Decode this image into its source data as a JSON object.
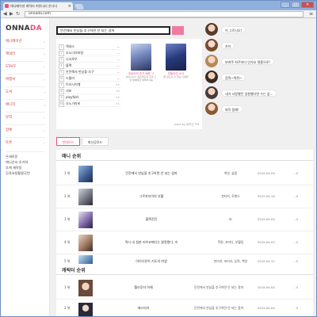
{
  "browser": {
    "tab_title": "애니메이션 캐릭터 커뮤니티 온나다",
    "tab_close": "×",
    "newtab": "",
    "url": "onnada.com",
    "back": "◀",
    "forward": "▶",
    "reload": "↻",
    "menu": "≡",
    "minimize": "_",
    "maximize": "□",
    "close": "×"
  },
  "sidebar": {
    "logo_main": "ONNA",
    "logo_accent": "DA",
    "items": [
      {
        "label": "애니메이션"
      },
      {
        "label": "캐릭터"
      },
      {
        "label": "STAFF"
      },
      {
        "label": "여행서"
      },
      {
        "label": "도서"
      },
      {
        "label": "애니작"
      },
      {
        "label": "뮤직"
      },
      {
        "label": "잡록"
      },
      {
        "label": "토론"
      }
    ],
    "links": [
      "온새로운",
      "애니순서 추가하",
      "추계 재작동",
      "무료요청활용무런"
    ]
  },
  "search": {
    "value": "안전해서 만났을 추구하면 안 되는 걸까"
  },
  "top_ranking": {
    "rows": [
      {
        "num": "1",
        "title": "액세스",
        "change": "—"
      },
      {
        "num": "2",
        "title": "오노다의비밀",
        "change": "—"
      },
      {
        "num": "3",
        "title": "나서로우",
        "change": "—"
      },
      {
        "num": "4",
        "title": "블랙",
        "change": "—"
      },
      {
        "num": "5",
        "title": "안전해서 만났을 추구",
        "change": "—"
      },
      {
        "num": "6",
        "title": "드롭러",
        "change": "—"
      },
      {
        "num": "7",
        "title": "트러시어웨",
        "change": "+1"
      },
      {
        "num": "8",
        "title": "서포",
        "change": "+2"
      },
      {
        "num": "9",
        "title": "playfold",
        "change": "+1"
      },
      {
        "num": "10",
        "title": "오노가라비",
        "change": "+1"
      }
    ],
    "thumb1_caption": "흐르라의 추가 배운 그",
    "thumb1_sub": "Pokemon 흐르라드의 조깍 그런 말에대한 제작하시음",
    "thumb2_caption": "만들어진 소녀",
    "thumb2_sub": "말 만드는 수 있는 시절을",
    "more_label": "more by 밝혀진 TM"
  },
  "tabs": [
    {
      "label": "판데모드"
    },
    {
      "label": "최신공모드"
    }
  ],
  "chats": [
    {
      "text": "이 그르시오!"
    },
    {
      "text": "카이"
    },
    {
      "text": "보여주 차르하다 인가요 명흥으로!"
    },
    {
      "text": "음뭐~뭐뭐~"
    },
    {
      "text": "내가 사랑했던 입항했다면 수는 없..."
    },
    {
      "text": "퇴작 함께!"
    }
  ],
  "anime_ranking": {
    "title": "애니 순위",
    "rows": [
      {
        "rank": "1 위",
        "title": "던전에서 만남을 추구하면 안 되는 걸까",
        "info": "액션, 슬픔",
        "date": "2015.04.04",
        "change": "- 0"
      },
      {
        "rank": "2 위",
        "title": "그르자지이의 부활",
        "info": "판타지, 로맨스",
        "date": "2015.04.19",
        "change": "- 0"
      },
      {
        "rank": "3 위",
        "title": "블랙전진",
        "info": "SF",
        "date": "2015.04.04",
        "change": "- 0"
      },
      {
        "rank": "4 위",
        "title": "역시 내 청춘 러브코메디는 잘못됐다. 속",
        "info": "학원, 코미디, 부활동",
        "date": "2015.04.03",
        "change": "- 0"
      },
      {
        "rank": "5 위",
        "title": "아이디온어 기도의 여생",
        "info": "판타지, 포러리, 능력, 액션",
        "date": "2015.04.12",
        "change": "- 0"
      }
    ]
  },
  "character_ranking": {
    "title": "캐릭터 순위",
    "rows": [
      {
        "rank": "1 위",
        "title": "헬리루자 아채",
        "info": "던전에서 만남을 추구하면 안 되는 걸까",
        "date": "2015.04.04",
        "change": "- 0"
      },
      {
        "rank": "2 위",
        "title": "헤스티아",
        "info": "던전에서 만남을 추구하면 안 되는 걸까",
        "date": "2015.04.04",
        "change": "- 0"
      }
    ]
  },
  "colors": {
    "accent": "#e8527a",
    "frame": "#6d8ec1"
  },
  "icons": [
    "favicon-icon",
    "back-arrow-icon",
    "forward-arrow-icon",
    "reload-icon",
    "menu-icon",
    "avatar-icon"
  ]
}
